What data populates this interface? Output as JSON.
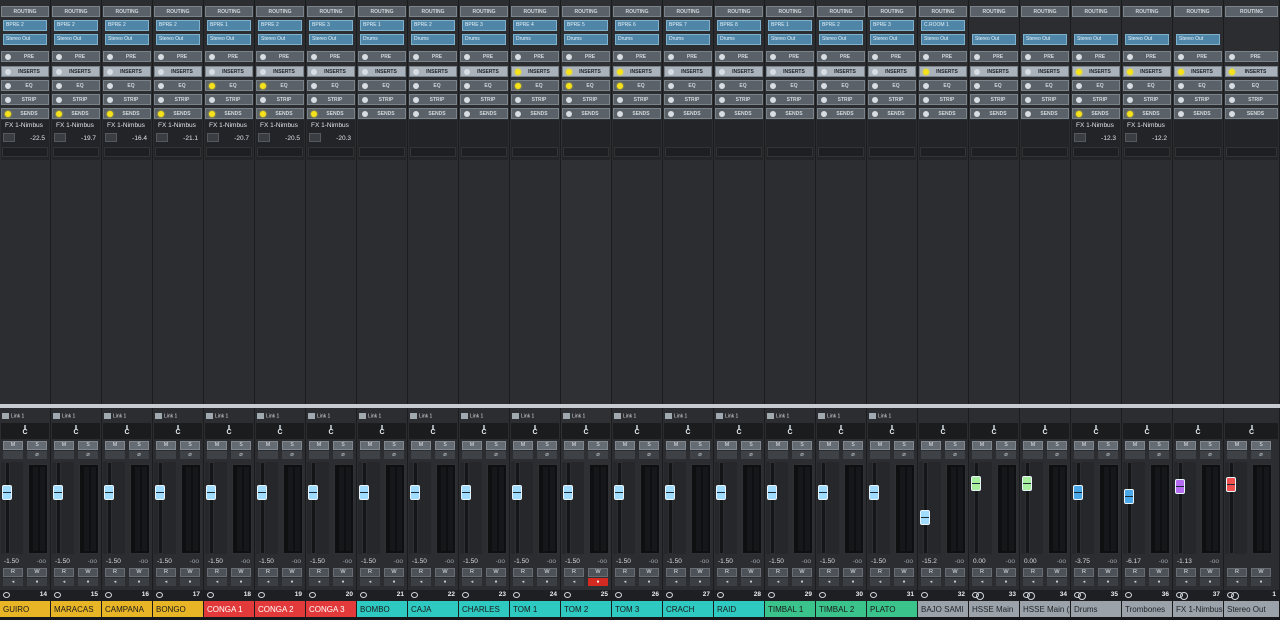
{
  "labels": {
    "routing": "ROUTING",
    "pre": "PRE",
    "inserts": "INSERTS",
    "eq": "EQ",
    "strip": "STRIP",
    "sends": "SENDS",
    "mute": "M",
    "solo": "S",
    "read": "R",
    "write": "W",
    "neg_inf": "-oo"
  },
  "colors": {
    "gold": "#e8b526",
    "red": "#e23a3a",
    "teal": "#2ec9c1",
    "green": "#3ac38a",
    "gray": "#9ba2aa",
    "fader_blue": "#9fdcff",
    "fader_green": "#a8f0a0",
    "fader_purple": "#b56cf0",
    "fader_red": "#f05050",
    "fader_mid": "#4aa8e8"
  },
  "channels": [
    {
      "name": "GUIRO",
      "number": "14",
      "in": "BPRE 2",
      "out": "Stereo Out",
      "send": "FX 1-Nimbus",
      "send_val": "-22.5",
      "link": "Link 1",
      "pan": "C",
      "vol": "-1.50",
      "peak": "-oo",
      "fader_pos": 0.3,
      "color": "gold",
      "fader_color": "fader_blue",
      "stereo": false,
      "ins_on": false,
      "eq_on": false,
      "sends_on": true
    },
    {
      "name": "MARACAS",
      "number": "15",
      "in": "BPRE 2",
      "out": "Stereo Out",
      "send": "FX 1-Nimbus",
      "send_val": "-19.7",
      "link": "Link 1",
      "pan": "C",
      "vol": "-1.50",
      "peak": "-oo",
      "fader_pos": 0.3,
      "color": "gold",
      "fader_color": "fader_blue",
      "stereo": false,
      "ins_on": false,
      "eq_on": false,
      "sends_on": true
    },
    {
      "name": "CAMPANA",
      "number": "16",
      "in": "BPRE 2",
      "out": "Stereo Out",
      "send": "FX 1-Nimbus",
      "send_val": "-16.4",
      "link": "Link 1",
      "pan": "C",
      "vol": "-1.50",
      "peak": "-oo",
      "fader_pos": 0.3,
      "color": "gold",
      "fader_color": "fader_blue",
      "stereo": false,
      "ins_on": false,
      "eq_on": false,
      "sends_on": true
    },
    {
      "name": "BONGO",
      "number": "17",
      "in": "BPRE 2",
      "out": "Stereo Out",
      "send": "FX 1-Nimbus",
      "send_val": "-21.1",
      "link": "Link 1",
      "pan": "C",
      "vol": "-1.50",
      "peak": "-oo",
      "fader_pos": 0.3,
      "color": "gold",
      "fader_color": "fader_blue",
      "stereo": false,
      "ins_on": false,
      "eq_on": false,
      "sends_on": true
    },
    {
      "name": "CONGA 1",
      "number": "18",
      "in": "BPRE 1",
      "out": "Stereo Out",
      "send": "FX 1-Nimbus",
      "send_val": "-20.7",
      "link": "Link 1",
      "pan": "C",
      "vol": "-1.50",
      "peak": "-oo",
      "fader_pos": 0.3,
      "color": "red",
      "fader_color": "fader_blue",
      "stereo": false,
      "ins_on": false,
      "eq_on": true,
      "sends_on": true
    },
    {
      "name": "CONGA 2",
      "number": "19",
      "in": "BPRE 2",
      "out": "Stereo Out",
      "send": "FX 1-Nimbus",
      "send_val": "-20.5",
      "link": "Link 1",
      "pan": "C",
      "vol": "-1.50",
      "peak": "-oo",
      "fader_pos": 0.3,
      "color": "red",
      "fader_color": "fader_blue",
      "stereo": false,
      "ins_on": false,
      "eq_on": true,
      "sends_on": true
    },
    {
      "name": "CONGA 3",
      "number": "20",
      "in": "BPRE 3",
      "out": "Stereo Out",
      "send": "FX 1-Nimbus",
      "send_val": "-20.3",
      "link": "Link 1",
      "pan": "C",
      "vol": "-1.50",
      "peak": "-oo",
      "fader_pos": 0.3,
      "color": "red",
      "fader_color": "fader_blue",
      "stereo": false,
      "ins_on": false,
      "eq_on": false,
      "sends_on": true
    },
    {
      "name": "BOMBO",
      "number": "21",
      "in": "BPRE 1",
      "out": "Drums",
      "send": "",
      "send_val": "",
      "link": "Link 1",
      "pan": "C",
      "vol": "-1.50",
      "peak": "-oo",
      "fader_pos": 0.3,
      "color": "teal",
      "fader_color": "fader_blue",
      "stereo": false,
      "ins_on": false,
      "eq_on": false,
      "sends_on": false
    },
    {
      "name": "CAJA",
      "number": "22",
      "in": "BPRE 2",
      "out": "Drums",
      "send": "",
      "send_val": "",
      "link": "Link 1",
      "pan": "C",
      "vol": "-1.50",
      "peak": "-oo",
      "fader_pos": 0.3,
      "color": "teal",
      "fader_color": "fader_blue",
      "stereo": false,
      "ins_on": false,
      "eq_on": false,
      "sends_on": false
    },
    {
      "name": "CHARLES",
      "number": "23",
      "in": "BPRE 3",
      "out": "Drums",
      "send": "",
      "send_val": "",
      "link": "Link 1",
      "pan": "C",
      "vol": "-1.50",
      "peak": "-oo",
      "fader_pos": 0.3,
      "color": "teal",
      "fader_color": "fader_blue",
      "stereo": false,
      "ins_on": false,
      "eq_on": false,
      "sends_on": false
    },
    {
      "name": "TOM 1",
      "number": "24",
      "in": "BPRE 4",
      "out": "Drums",
      "send": "",
      "send_val": "",
      "link": "Link 1",
      "pan": "C",
      "vol": "-1.50",
      "peak": "-oo",
      "fader_pos": 0.3,
      "color": "teal",
      "fader_color": "fader_blue",
      "stereo": false,
      "ins_on": true,
      "eq_on": true,
      "sends_on": false
    },
    {
      "name": "TOM 2",
      "number": "25",
      "in": "BPRE 5",
      "out": "Drums",
      "send": "",
      "send_val": "",
      "link": "Link 1",
      "pan": "C",
      "vol": "-1.50",
      "peak": "-oo",
      "fader_pos": 0.3,
      "color": "teal",
      "fader_color": "fader_blue",
      "stereo": false,
      "ins_on": true,
      "eq_on": true,
      "sends_on": false,
      "selected": true,
      "rec": true
    },
    {
      "name": "TOM 3",
      "number": "26",
      "in": "BPRE 6",
      "out": "Drums",
      "send": "",
      "send_val": "",
      "link": "Link 1",
      "pan": "C",
      "vol": "-1.50",
      "peak": "-oo",
      "fader_pos": 0.3,
      "color": "teal",
      "fader_color": "fader_blue",
      "stereo": false,
      "ins_on": true,
      "eq_on": true,
      "sends_on": false
    },
    {
      "name": "CRACH",
      "number": "27",
      "in": "BPRE 7",
      "out": "Drums",
      "send": "",
      "send_val": "",
      "link": "Link 1",
      "pan": "C",
      "vol": "-1.50",
      "peak": "-oo",
      "fader_pos": 0.3,
      "color": "teal",
      "fader_color": "fader_blue",
      "stereo": false,
      "ins_on": false,
      "eq_on": false,
      "sends_on": false
    },
    {
      "name": "RAID",
      "number": "28",
      "in": "BPRE 8",
      "out": "Drums",
      "send": "",
      "send_val": "",
      "link": "Link 1",
      "pan": "C",
      "vol": "-1.50",
      "peak": "-oo",
      "fader_pos": 0.3,
      "color": "teal",
      "fader_color": "fader_blue",
      "stereo": false,
      "ins_on": false,
      "eq_on": false,
      "sends_on": false
    },
    {
      "name": "TIMBAL 1",
      "number": "29",
      "in": "BPRE 1",
      "out": "Stereo Out",
      "send": "",
      "send_val": "",
      "link": "Link 1",
      "pan": "C",
      "vol": "-1.50",
      "peak": "-oo",
      "fader_pos": 0.3,
      "color": "green",
      "fader_color": "fader_blue",
      "stereo": false,
      "ins_on": false,
      "eq_on": false,
      "sends_on": false
    },
    {
      "name": "TIMBAL 2",
      "number": "30",
      "in": "BPRE 2",
      "out": "Stereo Out",
      "send": "",
      "send_val": "",
      "link": "Link 1",
      "pan": "C",
      "vol": "-1.50",
      "peak": "-oo",
      "fader_pos": 0.3,
      "color": "green",
      "fader_color": "fader_blue",
      "stereo": false,
      "ins_on": false,
      "eq_on": false,
      "sends_on": false
    },
    {
      "name": "PLATO",
      "number": "31",
      "in": "BPRE 3",
      "out": "Stereo Out",
      "send": "",
      "send_val": "",
      "link": "Link 1",
      "pan": "C",
      "vol": "-1.50",
      "peak": "-oo",
      "fader_pos": 0.3,
      "color": "green",
      "fader_color": "fader_blue",
      "stereo": false,
      "ins_on": false,
      "eq_on": false,
      "sends_on": false
    },
    {
      "name": "BAJO SAMI",
      "number": "32",
      "in": "C.ROOM 1",
      "out": "Stereo Out",
      "send": "",
      "send_val": "",
      "link": "",
      "pan": "C",
      "vol": "-15.2",
      "peak": "-oo",
      "fader_pos": 0.62,
      "color": "gray",
      "fader_color": "fader_blue",
      "stereo": false,
      "ins_on": true,
      "eq_on": false,
      "sends_on": false
    },
    {
      "name": "HSSE Main",
      "number": "33",
      "in": "",
      "out": "Stereo Out",
      "send": "",
      "send_val": "",
      "link": "",
      "pan": "C",
      "vol": "0.00",
      "peak": "-oo",
      "fader_pos": 0.18,
      "color": "gray",
      "fader_color": "fader_green",
      "stereo": true,
      "ins_on": false,
      "eq_on": false,
      "sends_on": false
    },
    {
      "name": "HSSE Main (2)",
      "number": "34",
      "in": "",
      "out": "Stereo Out",
      "send": "",
      "send_val": "",
      "link": "",
      "pan": "C",
      "vol": "0.00",
      "peak": "-oo",
      "fader_pos": 0.18,
      "color": "gray",
      "fader_color": "fader_green",
      "stereo": true,
      "ins_on": false,
      "eq_on": false,
      "sends_on": false
    },
    {
      "name": "Drums",
      "number": "35",
      "in": "",
      "out": "Stereo Out",
      "send": "FX 1-Nimbus",
      "send_val": "-12.3",
      "link": "",
      "pan": "C",
      "vol": "-3.75",
      "peak": "-oo",
      "fader_pos": 0.3,
      "color": "gray",
      "fader_color": "fader_mid",
      "stereo": true,
      "ins_on": true,
      "eq_on": false,
      "sends_on": true
    },
    {
      "name": "Trombones",
      "number": "36",
      "in": "",
      "out": "Stereo Out",
      "send": "FX 1-Nimbus",
      "send_val": "-12.2",
      "link": "",
      "pan": "C",
      "vol": "-6.17",
      "peak": "-oo",
      "fader_pos": 0.35,
      "color": "gray",
      "fader_color": "fader_mid",
      "stereo": false,
      "ins_on": true,
      "eq_on": false,
      "sends_on": true
    },
    {
      "name": "FX 1-Nimbus",
      "number": "37",
      "in": "",
      "out": "Stereo Out",
      "send": "",
      "send_val": "",
      "link": "",
      "pan": "C",
      "vol": "-1.13",
      "peak": "-oo",
      "fader_pos": 0.22,
      "color": "gray",
      "fader_color": "fader_purple",
      "stereo": true,
      "ins_on": true,
      "eq_on": false,
      "sends_on": false
    },
    {
      "name": "Stereo Out",
      "number": "1",
      "in": "",
      "out": "",
      "send": "",
      "send_val": "",
      "link": "",
      "pan": "C",
      "vol": "",
      "peak": "",
      "fader_pos": 0.2,
      "color": "gray",
      "fader_color": "fader_red",
      "stereo": true,
      "ins_on": true,
      "eq_on": false,
      "sends_on": false
    }
  ]
}
